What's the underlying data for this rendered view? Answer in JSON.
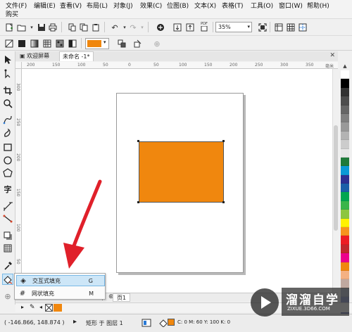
{
  "menu": {
    "file": "文件(F)",
    "edit": "编辑(E)",
    "view": "查看(V)",
    "layout": "布局(L)",
    "object": "对象(J)",
    "effects": "效果(C)",
    "bitmaps": "位图(B)",
    "text": "文本(X)",
    "table": "表格(T)",
    "tools": "工具(O)",
    "window": "窗口(W)",
    "help": "帮助(H)",
    "buy": "购买"
  },
  "toolbar": {
    "zoom_value": "35%",
    "pdf_label": "PDF"
  },
  "property_bar": {
    "fill_color": "#f0870e"
  },
  "tabs": {
    "welcome": "欢迎屏幕",
    "document": "未命名 -1*"
  },
  "ruler": {
    "labels": [
      "200",
      "150",
      "100",
      "50",
      "0",
      "50",
      "100",
      "150",
      "200",
      "250",
      "300",
      "350"
    ],
    "unit": "毫米",
    "left_labels": [
      "300",
      "250",
      "200",
      "150",
      "100",
      "50"
    ]
  },
  "flyout": {
    "items": [
      {
        "label": "交互式填充",
        "shortcut": "G",
        "icon": "interactive-fill-icon"
      },
      {
        "label": "网状填充",
        "shortcut": "M",
        "icon": "mesh-fill-icon"
      }
    ]
  },
  "page_nav": {
    "page_tab": "页1"
  },
  "status": {
    "coords": "( -146.866, 148.874 )",
    "object_info": "矩形 于 图层 1",
    "fill_info": "C: 0 M: 60 Y: 100 K: 0",
    "fill_color": "#f0870e"
  },
  "canvas": {
    "rect_color": "#f0870e"
  },
  "palette_colors": [
    "#ffffff",
    "#000000",
    "#333333",
    "#4d4d4d",
    "#666666",
    "#808080",
    "#999999",
    "#b3b3b3",
    "#cccccc",
    "#e6e6e6",
    "#1f7a3a",
    "#0b9ad6",
    "#2e3192",
    "#1c5fa8",
    "#00a651",
    "#39b54a",
    "#8dc63f",
    "#fff200",
    "#f7941d",
    "#ed1c24",
    "#c1272d",
    "#ec008c",
    "#f0870e",
    "#f4b183",
    "#c0a8a0",
    "#b0b8c8",
    "#8c96c8",
    "#6f7ab4",
    "#9aa8d8",
    "#c8cce8"
  ],
  "watermark": {
    "brand": "溜溜自学",
    "url": "ZIXUE.3D66.COM"
  }
}
